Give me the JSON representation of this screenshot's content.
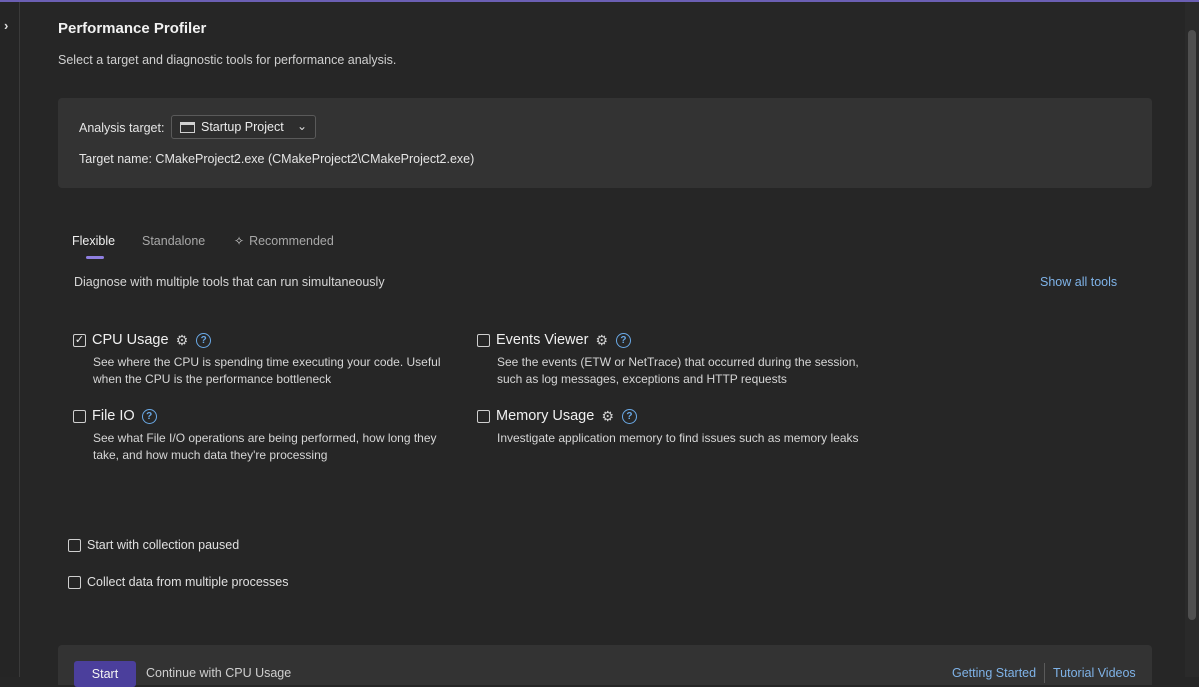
{
  "window": {
    "sidebar_toggle_icon": "chevron-right-icon",
    "title": "Performance Profiler",
    "subtitle": "Select a target and diagnostic tools for performance analysis."
  },
  "target": {
    "label": "Analysis target:",
    "dropdown_value": "Startup Project",
    "dropdown_icon": "window-icon",
    "target_name": "Target name: CMakeProject2.exe (CMakeProject2\\CMakeProject2.exe)"
  },
  "tabs": [
    {
      "label": "Flexible",
      "active": true
    },
    {
      "label": "Standalone",
      "active": false
    },
    {
      "label": "Recommended",
      "active": false,
      "icon": "sparkle-icon"
    }
  ],
  "tools_panel": {
    "description": "Diagnose with multiple tools that can run simultaneously",
    "show_all_label": "Show all tools"
  },
  "tools": [
    {
      "name": "CPU Usage",
      "checked": true,
      "has_settings": true,
      "desc": "See where the CPU is spending time executing your code. Useful when the CPU is the performance bottleneck"
    },
    {
      "name": "Events Viewer",
      "checked": false,
      "has_settings": true,
      "desc": "See the events (ETW or NetTrace) that occurred during the session, such as log messages, exceptions and HTTP requests"
    },
    {
      "name": "File IO",
      "checked": false,
      "has_settings": false,
      "desc": "See what File I/O operations are being performed, how long they take, and how much data they're processing"
    },
    {
      "name": "Memory Usage",
      "checked": false,
      "has_settings": true,
      "desc": "Investigate application memory to find issues such as memory leaks"
    }
  ],
  "options": [
    {
      "label": "Start with collection paused",
      "checked": false
    },
    {
      "label": "Collect data from multiple processes",
      "checked": false
    }
  ],
  "footer": {
    "start_label": "Start",
    "continue_text": "Continue with CPU Usage",
    "getting_started": "Getting Started",
    "tutorial_videos": "Tutorial Videos"
  },
  "colors": {
    "background": "#262626",
    "panel": "#333333",
    "accent": "#4b3f9c",
    "tab_indicator": "#8f7fe0",
    "link": "#7fb3e8"
  }
}
